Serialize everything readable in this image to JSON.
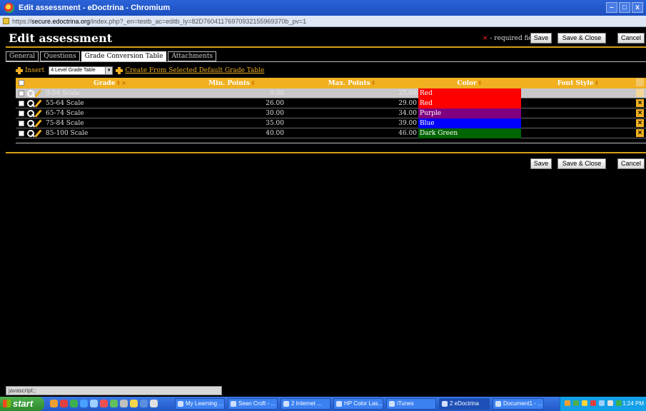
{
  "window": {
    "title": "Edit assessment - eDoctrina - Chromium",
    "url_prefix": "https://",
    "url_host": "secure.edoctrina.org",
    "url_path": "/index.php?_en=testb_ac=editb_ly=82D76041176970932155969370b_pv=1"
  },
  "header": {
    "title": "Edit assessment",
    "required_note": " - required fields",
    "save_label": "Save",
    "save_close_label": "Save & Close",
    "cancel_label": "Cancel"
  },
  "tabs": [
    {
      "label": "General",
      "active": false
    },
    {
      "label": "Questions",
      "active": false
    },
    {
      "label": "Grade Conversion Table",
      "active": true
    },
    {
      "label": "Attachments",
      "active": false
    }
  ],
  "toolbar": {
    "insert_label": "Insert",
    "template_select_value": "4 Level Grade Table",
    "create_default_label": "Create From Selected Default Grade Table"
  },
  "table": {
    "columns": [
      "Grade",
      "Min. Points",
      "Max. Points",
      "Color",
      "Font Style"
    ],
    "rows": [
      {
        "grade": "0-54 Scale",
        "min": "0.00",
        "max": "25.00",
        "color": "Red",
        "color_hex": "#ff0000",
        "font_style": ""
      },
      {
        "grade": "55-64 Scale",
        "min": "26.00",
        "max": "29.00",
        "color": "Red",
        "color_hex": "#ff0000",
        "font_style": ""
      },
      {
        "grade": "65-74 Scale",
        "min": "30.00",
        "max": "34.00",
        "color": "Purple",
        "color_hex": "#800080",
        "font_style": ""
      },
      {
        "grade": "75-84 Scale",
        "min": "35.00",
        "max": "39.00",
        "color": "Blue",
        "color_hex": "#0000ff",
        "font_style": ""
      },
      {
        "grade": "85-100 Scale",
        "min": "40.00",
        "max": "46.00",
        "color": "Dark Green",
        "color_hex": "#006400",
        "font_style": ""
      }
    ]
  },
  "statusbar": {
    "text": "javascript:;"
  },
  "taskbar": {
    "start_label": "start",
    "tasks": [
      {
        "label": "My Learning ..."
      },
      {
        "label": "Sean Croft - ..."
      },
      {
        "label": "2 Internet ..."
      },
      {
        "label": "HP Color Las..."
      },
      {
        "label": "iTunes"
      },
      {
        "label": "2 eDoctrina"
      },
      {
        "label": "Document1 - ..."
      }
    ],
    "clock": "1:24 PM"
  },
  "colors": {
    "accent": "#f0b020",
    "header_rule": "#d4a017",
    "background": "#000000"
  }
}
